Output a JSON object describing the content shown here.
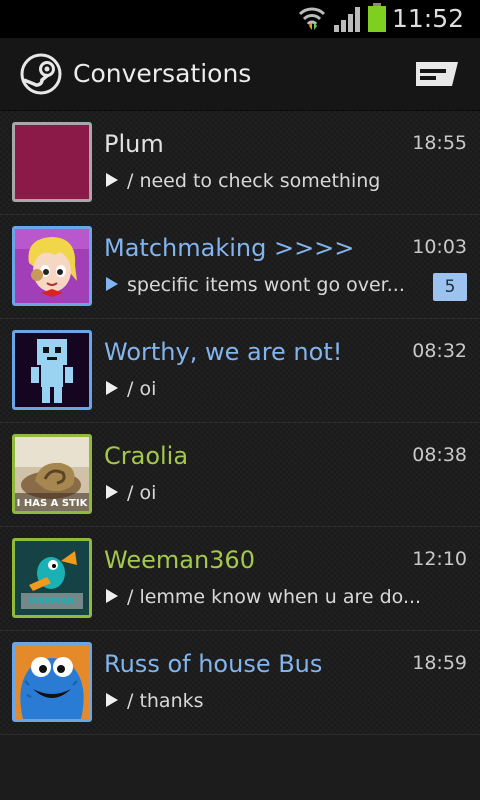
{
  "status_bar": {
    "time": "11:52",
    "icons": [
      "wifi-icon",
      "signal-icon",
      "battery-icon"
    ]
  },
  "action_bar": {
    "title": "Conversations",
    "logo_icon": "steam-logo-icon",
    "compose_icon": "new-message-icon"
  },
  "status_colors": {
    "online": "#82b4ee",
    "ingame": "#a4c84c",
    "offline": "#e2e2e2"
  },
  "conversations": [
    {
      "name": "Plum",
      "time": "18:55",
      "message": "/ need to check something",
      "status": "offline",
      "avatar_icon": "plum-color-avatar-icon"
    },
    {
      "name": "Matchmaking >>>>",
      "time": "10:03",
      "message": "specific items wont go over...",
      "status": "online",
      "unread": "5",
      "avatar_icon": "cartoon-girl-avatar-icon"
    },
    {
      "name": "Worthy, we are not!",
      "time": "08:32",
      "message": "/ oi",
      "status": "online",
      "avatar_icon": "pixel-robot-avatar-icon"
    },
    {
      "name": "Craolia",
      "time": "08:38",
      "message": "/ oi",
      "status": "ingame",
      "avatar_icon": "snail-avatar-icon",
      "avatar_caption": "I HAS A STIK"
    },
    {
      "name": "Weeman360",
      "time": "12:10",
      "message": "/ lemme know when u are do...",
      "status": "ingame",
      "avatar_icon": "platypus-avatar-icon",
      "avatar_caption": "WEEMAN"
    },
    {
      "name": "Russ of house Bus",
      "time": "18:59",
      "message": "/ thanks",
      "status": "online",
      "avatar_icon": "cookie-monster-avatar-icon"
    }
  ]
}
